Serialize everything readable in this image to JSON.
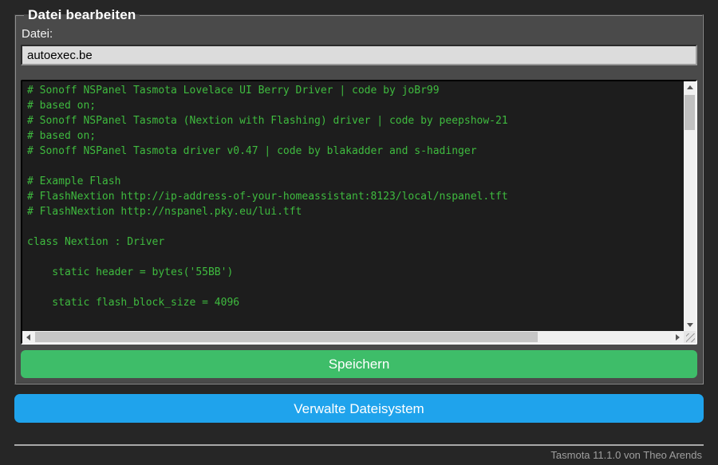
{
  "colors": {
    "page_bg": "#262626",
    "panel_bg": "#4a4a4a",
    "code_bg": "#1d1d1d",
    "code_text_green": "#3fbb3f",
    "save_button_green": "#3ebd69",
    "manage_button_blue": "#1fa3ec",
    "input_bg": "#dcdcdc"
  },
  "editor": {
    "legend": "Datei bearbeiten",
    "file_label": "Datei:",
    "file_input_value": "autoexec.be",
    "file_content": "# Sonoff NSPanel Tasmota Lovelace UI Berry Driver | code by joBr99\n# based on;\n# Sonoff NSPanel Tasmota (Nextion with Flashing) driver | code by peepshow-21\n# based on;\n# Sonoff NSPanel Tasmota driver v0.47 | code by blakadder and s-hadinger\n\n# Example Flash\n# FlashNextion http://ip-address-of-your-homeassistant:8123/local/nspanel.tft\n# FlashNextion http://nspanel.pky.eu/lui.tft\n\nclass Nextion : Driver\n\n    static header = bytes('55BB')\n\n    static flash_block_size = 4096",
    "save_button": "Speichern"
  },
  "manage_fs_button": "Verwalte Dateisystem",
  "footer": {
    "version_text": "Tasmota 11.1.0 von Theo Arends"
  },
  "icons": {
    "scroll_up": "triangle-up",
    "scroll_down": "triangle-down",
    "scroll_left": "triangle-left",
    "scroll_right": "triangle-right",
    "resize_grip": "diagonal-lines"
  }
}
